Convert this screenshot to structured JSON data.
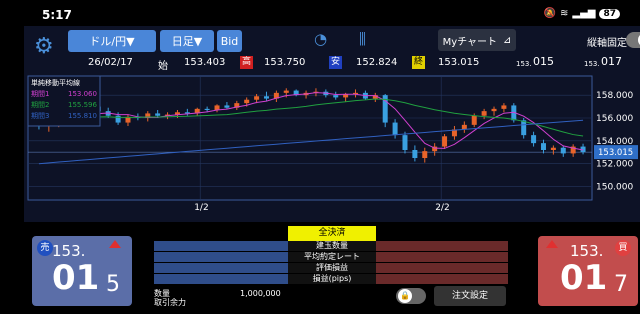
{
  "status": {
    "time": "5:17",
    "battery": "87"
  },
  "toolbar": {
    "pair": "ドル/円▼",
    "timeframe": "日足▼",
    "side": "Bid",
    "mychart": "Myチャート",
    "axis_fix": "縦軸固定"
  },
  "ohlc": {
    "date": "26/02/17",
    "open_label": "始",
    "open": "153.403",
    "high_label": "高",
    "high": "153.750",
    "low_label": "安",
    "low": "152.824",
    "close_label": "終",
    "close": "153.015",
    "bid_prefix": "153.",
    "bid_big": "01",
    "bid_small": "5",
    "ask_prefix": "153.",
    "ask_big": "01",
    "ask_small": "7"
  },
  "legend": {
    "title": "単純移動平均線",
    "items": [
      {
        "label": "期間1",
        "value": "153.060",
        "color": "#d040d0"
      },
      {
        "label": "期間2",
        "value": "155.596",
        "color": "#20a040"
      },
      {
        "label": "期間3",
        "value": "155.810",
        "color": "#3060c0"
      }
    ]
  },
  "axis": {
    "y_ticks": [
      "158.000",
      "156.000",
      "154.000",
      "152.000",
      "150.000"
    ],
    "current": "153.015",
    "x_ticks": [
      "1/2",
      "2/2"
    ]
  },
  "chart_data": {
    "type": "candlestick",
    "ylim": [
      149,
      159.5
    ],
    "candles": [
      [
        155.8,
        156.1,
        155.0,
        155.3
      ],
      [
        155.3,
        155.6,
        154.8,
        155.5
      ],
      [
        155.5,
        156.0,
        155.2,
        155.9
      ],
      [
        155.9,
        156.5,
        155.7,
        156.3
      ],
      [
        156.3,
        156.8,
        155.9,
        156.1
      ],
      [
        156.1,
        157.2,
        156.0,
        157.0
      ],
      [
        157.0,
        157.3,
        156.4,
        156.6
      ],
      [
        156.6,
        156.9,
        156.0,
        156.2
      ],
      [
        156.2,
        156.5,
        155.4,
        155.6
      ],
      [
        155.6,
        156.3,
        155.3,
        156.1
      ],
      [
        156.1,
        156.4,
        155.8,
        156.0
      ],
      [
        156.0,
        156.6,
        155.7,
        156.4
      ],
      [
        156.4,
        156.7,
        156.0,
        156.2
      ],
      [
        156.2,
        156.5,
        155.9,
        156.3
      ],
      [
        156.3,
        156.7,
        156.0,
        156.5
      ],
      [
        156.5,
        156.8,
        156.2,
        156.4
      ],
      [
        156.4,
        156.9,
        156.2,
        156.8
      ],
      [
        156.8,
        157.0,
        156.5,
        156.7
      ],
      [
        156.7,
        157.2,
        156.5,
        157.1
      ],
      [
        157.1,
        157.4,
        156.8,
        156.9
      ],
      [
        156.9,
        157.5,
        156.7,
        157.3
      ],
      [
        157.3,
        157.8,
        157.0,
        157.6
      ],
      [
        157.6,
        158.1,
        157.3,
        157.9
      ],
      [
        157.9,
        158.3,
        157.5,
        157.7
      ],
      [
        157.7,
        158.4,
        157.4,
        158.2
      ],
      [
        158.2,
        158.6,
        157.8,
        158.4
      ],
      [
        158.4,
        158.5,
        157.9,
        158.0
      ],
      [
        158.0,
        158.4,
        157.7,
        158.2
      ],
      [
        158.2,
        158.6,
        157.9,
        158.3
      ],
      [
        158.3,
        158.5,
        157.8,
        158.0
      ],
      [
        158.0,
        158.3,
        157.6,
        157.8
      ],
      [
        157.8,
        158.2,
        157.4,
        158.1
      ],
      [
        158.1,
        158.5,
        157.8,
        158.2
      ],
      [
        158.2,
        158.4,
        157.6,
        157.7
      ],
      [
        157.7,
        158.2,
        157.4,
        158.0
      ],
      [
        158.0,
        158.1,
        155.2,
        155.6
      ],
      [
        155.6,
        155.9,
        154.2,
        154.5
      ],
      [
        154.5,
        154.8,
        152.9,
        153.2
      ],
      [
        153.2,
        153.6,
        152.2,
        152.5
      ],
      [
        152.5,
        153.4,
        152.1,
        153.1
      ],
      [
        153.1,
        153.8,
        152.7,
        153.5
      ],
      [
        153.5,
        154.6,
        153.3,
        154.4
      ],
      [
        154.4,
        155.3,
        154.1,
        155.0
      ],
      [
        155.0,
        155.7,
        154.7,
        155.4
      ],
      [
        155.4,
        156.4,
        155.2,
        156.2
      ],
      [
        156.2,
        156.8,
        155.9,
        156.6
      ],
      [
        156.6,
        157.0,
        156.2,
        156.8
      ],
      [
        156.8,
        157.3,
        156.5,
        157.1
      ],
      [
        157.1,
        157.3,
        155.6,
        155.8
      ],
      [
        155.8,
        156.0,
        154.2,
        154.5
      ],
      [
        154.5,
        154.8,
        153.5,
        153.8
      ],
      [
        153.8,
        154.1,
        152.9,
        153.2
      ],
      [
        153.2,
        153.6,
        152.8,
        153.4
      ],
      [
        153.4,
        153.6,
        152.6,
        152.9
      ],
      [
        152.9,
        153.7,
        152.6,
        153.5
      ],
      [
        153.5,
        153.75,
        152.82,
        153.015
      ]
    ]
  },
  "trade": {
    "sell_label": "売",
    "buy_label": "買",
    "close_all": "全決済",
    "rows": [
      "建玉数量",
      "平均約定レート",
      "評価損益",
      "損益(pips)"
    ],
    "qty_label": "数量",
    "margin_label": "取引余力",
    "qty_value": "1,000,000",
    "order_settings": "注文設定"
  }
}
